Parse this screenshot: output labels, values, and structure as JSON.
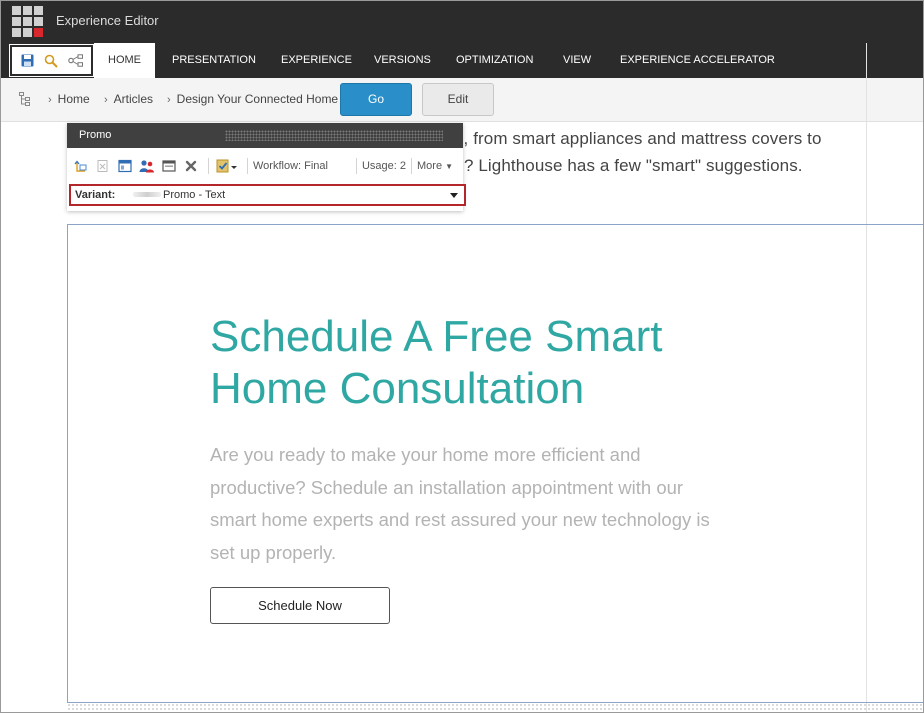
{
  "app": {
    "title": "Experience Editor"
  },
  "ribbon": {
    "quick_tools": [
      {
        "name": "save-icon"
      },
      {
        "name": "search-icon"
      },
      {
        "name": "share-icon"
      }
    ],
    "tabs": [
      {
        "label": "HOME",
        "active": true
      },
      {
        "label": "PRESENTATION"
      },
      {
        "label": "EXPERIENCE"
      },
      {
        "label": "VERSIONS"
      },
      {
        "label": "OPTIMIZATION"
      },
      {
        "label": "VIEW"
      },
      {
        "label": "EXPERIENCE ACCELERATOR"
      }
    ]
  },
  "breadcrumb": {
    "items": [
      "Home",
      "Articles",
      "Design Your Connected Home"
    ],
    "go_label": "Go",
    "edit_label": "Edit"
  },
  "page": {
    "body_line_1": "e, from smart appliances and mattress covers to",
    "body_line_2": "? Lighthouse has a few \"smart\" suggestions.",
    "promo": {
      "heading_line_1": "Schedule A Free Smart",
      "heading_line_2": "Home Consultation",
      "text": "Are you ready to make your home more efficient and productive? Schedule an installation appointment with our smart home experts and rest assured your new technology is set up properly.",
      "button_label": "Schedule Now"
    }
  },
  "promo_toolbar": {
    "title": "Promo",
    "workflow": "Workflow: Final",
    "usage": "Usage: 2",
    "more": "More",
    "variant_label": "Variant:",
    "variant_value": "Promo - Text"
  },
  "colors": {
    "appbar": "#2b2b2b",
    "go_button": "#2a8fc9",
    "heading": "#2fa8a3",
    "variant_border": "#b3262b"
  }
}
